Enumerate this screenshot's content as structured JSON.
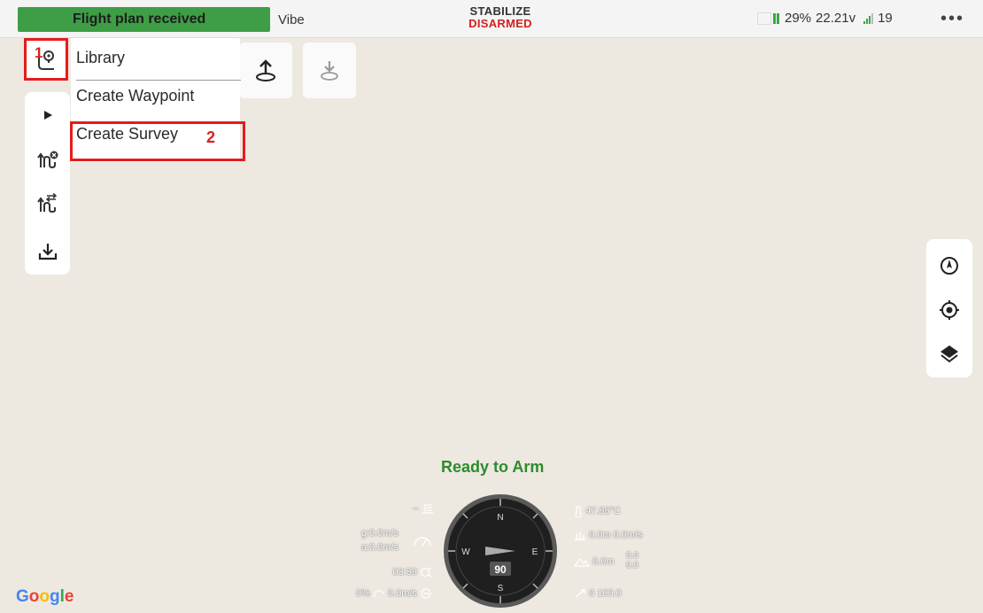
{
  "topbar": {
    "flight_status": "Flight plan received",
    "vehicle_name": "Vibe",
    "mode": "STABILIZE",
    "arm_state": "DISARMED",
    "battery_percent": "29%",
    "voltage": "22.21v",
    "satellites": "19",
    "more": "•••"
  },
  "annotations": {
    "step1": "1",
    "step2": "2"
  },
  "menu": {
    "items": [
      {
        "label": "Library"
      },
      {
        "label": "Create Waypoint"
      },
      {
        "label": "Create Survey"
      }
    ]
  },
  "hud": {
    "status": "Ready to Arm",
    "left": {
      "alt_indicator": "--",
      "ground_speed": "g:0.0m/s",
      "air_speed": "a:0.0m/s",
      "flight_time": "03:59",
      "throttle": "0%",
      "climb_rate": "0.0m/s"
    },
    "right": {
      "temperature": "47.85°C",
      "altitude": "0.0m 0.0m/s",
      "terrain_alt": "0.0m",
      "terrain_val_top": "0.0",
      "terrain_val_bottom": "0.0",
      "wp_info": "0 100.0"
    },
    "compass": {
      "heading": "90",
      "n": "N",
      "s": "S",
      "e": "E",
      "w": "W"
    }
  },
  "map": {
    "attribution": "Google"
  },
  "colors": {
    "status_green": "#3e9e46",
    "disarmed_red": "#d32020",
    "ready_green": "#2e8b2e",
    "annotation_red": "#e41c1c"
  }
}
